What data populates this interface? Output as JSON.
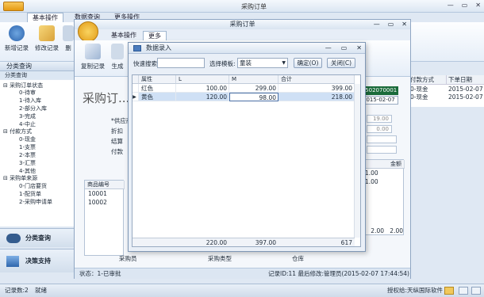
{
  "app": {
    "title": "采购订单",
    "tabs": [
      "基本操作",
      "数据查询",
      "更多操作"
    ],
    "ribbon_buttons": [
      "新增记录",
      "修改记录",
      "删"
    ]
  },
  "nav": {
    "header": "分类查询",
    "subheader": "分类查询",
    "tree": [
      {
        "label": "采购订单状态",
        "level": 1
      },
      {
        "label": "0-待审",
        "level": 2
      },
      {
        "label": "1-待入库",
        "level": 2
      },
      {
        "label": "2-部分入库",
        "level": 2
      },
      {
        "label": "3-完成",
        "level": 2
      },
      {
        "label": "4-中止",
        "level": 2
      },
      {
        "label": "付款方式",
        "level": 1
      },
      {
        "label": "0-现金",
        "level": 2
      },
      {
        "label": "1-支票",
        "level": 2
      },
      {
        "label": "2-本票",
        "level": 2
      },
      {
        "label": "3-汇票",
        "level": 2
      },
      {
        "label": "4-其他",
        "level": 2
      },
      {
        "label": "采购单来源",
        "level": 1
      },
      {
        "label": "0-门店要货",
        "level": 2
      },
      {
        "label": "1-配货单",
        "level": 2
      },
      {
        "label": "2-采购申请单",
        "level": 2
      }
    ],
    "bottom_buttons": [
      "分类查询",
      "决策支持"
    ]
  },
  "right_grid": {
    "headers": [
      "付款方式",
      "下单日期"
    ],
    "rows": [
      [
        "0-现金",
        "2015-02-07"
      ],
      [
        "0-现金",
        "2015-02-07"
      ]
    ]
  },
  "middle_window": {
    "title": "采购订单",
    "tabs": [
      "基本操作",
      "更多"
    ],
    "ribbon_buttons": [
      "复制记录",
      "生成"
    ],
    "page_title": "采购订...",
    "labels": [
      "*供应商",
      "折扣",
      "结算",
      "付款"
    ],
    "fields": [
      "19.00",
      "0.00"
    ],
    "order_no": "1502070001",
    "order_date": "2015-02-07",
    "items_header": "商品编号",
    "items": [
      "10001",
      "10002"
    ],
    "right_col_header": "金额",
    "right_col_values": [
      "1.00",
      "1.00"
    ],
    "right_foot": [
      "2.00",
      "2.00"
    ],
    "bottom_labels": [
      "采购员",
      "采购类型",
      "仓库"
    ],
    "status_left": "状态：1-已审批",
    "status_right": "记录ID:11    最后修改:管理员(2015-02-07 17:44:54)"
  },
  "dialog": {
    "title": "数据录入",
    "quick_search_label": "快速搜索:",
    "template_label": "选择模板:",
    "template_value": "童装",
    "ok_button": "确定(O)",
    "close_button": "关闭(C)",
    "columns": [
      "属性",
      "L",
      "M",
      "合计"
    ],
    "rows": [
      {
        "attr": "红色",
        "L": "100.00",
        "M": "299.00",
        "total": "399.00"
      },
      {
        "attr": "黄色",
        "L": "120.00",
        "M": "98.00",
        "total": "218.00"
      }
    ],
    "footer": {
      "L": "220.00",
      "M": "397.00",
      "total": "617"
    }
  },
  "statusbar": {
    "records": "记录数:2",
    "ready": "就绪",
    "license": "授权给:天纵国际软件"
  },
  "colors": {
    "accent": "#2d5a96",
    "selected_row": "#cfe0f5",
    "order_badge": "#1a6b3a"
  }
}
